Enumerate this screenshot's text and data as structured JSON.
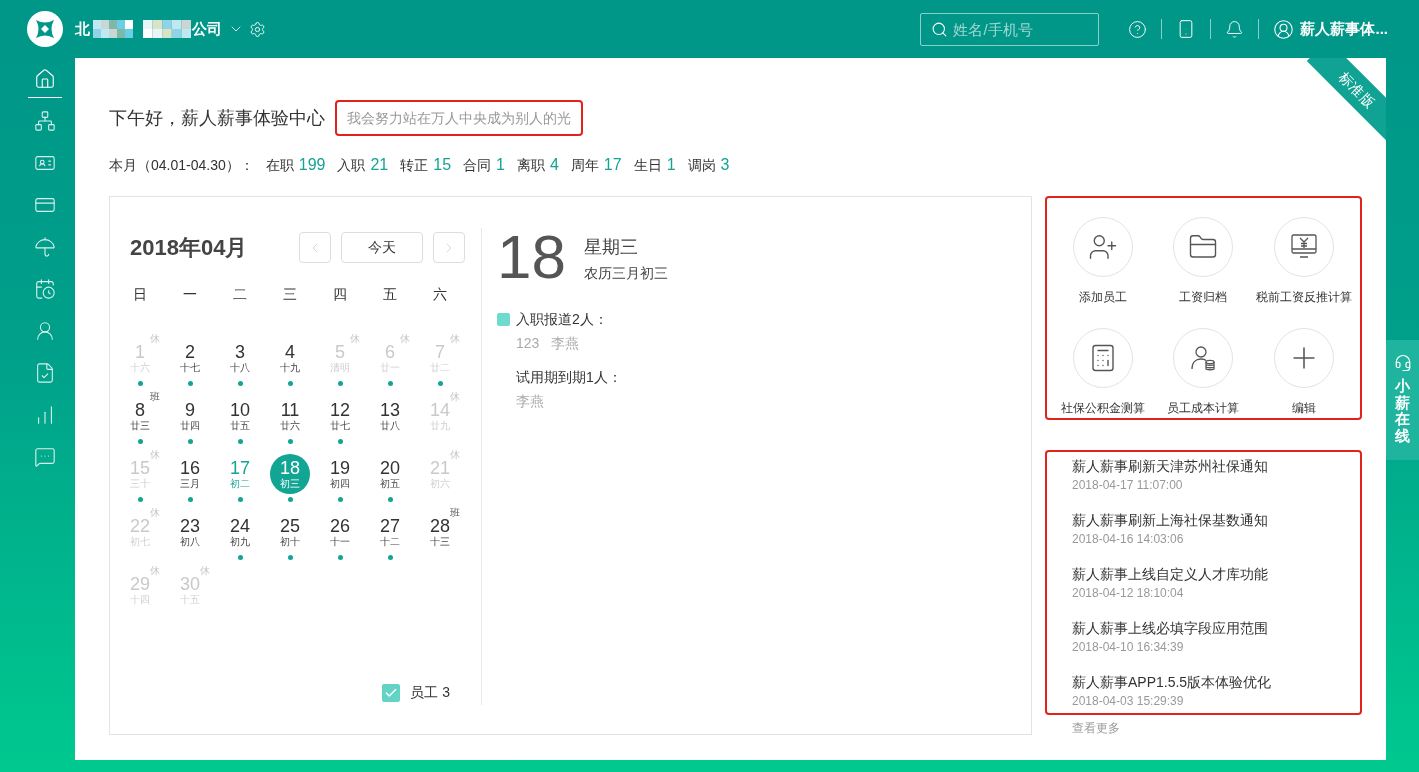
{
  "header": {
    "company_prefix": "北",
    "company_suffix": "公司",
    "search": {
      "placeholder": "姓名/手机号"
    },
    "user_name": "薪人薪事体..."
  },
  "sidebar": {
    "items": [
      {
        "selected": true
      },
      {
        "selected": false
      },
      {
        "selected": false
      },
      {
        "selected": false
      },
      {
        "selected": false
      },
      {
        "selected": false
      },
      {
        "selected": false
      },
      {
        "selected": false
      },
      {
        "selected": false
      },
      {
        "selected": false
      }
    ]
  },
  "edition_ribbon": "标准版",
  "greeting": "下午好，薪人薪事体验中心",
  "motto": {
    "text": "我会努力站在万人中央成为别人的光",
    "highlighted": true
  },
  "month_stats": {
    "label": "本月（04.01-04.30）：",
    "items": [
      {
        "label": "在职",
        "value": "199"
      },
      {
        "label": "入职",
        "value": "21"
      },
      {
        "label": "转正",
        "value": "15"
      },
      {
        "label": "合同",
        "value": "1"
      },
      {
        "label": "离职",
        "value": "4"
      },
      {
        "label": "周年",
        "value": "17"
      },
      {
        "label": "生日",
        "value": "1"
      },
      {
        "label": "调岗",
        "value": "3"
      }
    ]
  },
  "calendar": {
    "title": "2018年04月",
    "today_button": "今天",
    "weekdays": [
      "日",
      "一",
      "二",
      "三",
      "四",
      "五",
      "六"
    ],
    "weeks": [
      [
        {
          "day": "1",
          "lunar": "十六",
          "mark": "休",
          "muted": true,
          "accent": false,
          "selected": false,
          "dot": true
        },
        {
          "day": "2",
          "lunar": "十七",
          "muted": false,
          "accent": false,
          "selected": false,
          "dot": true
        },
        {
          "day": "3",
          "lunar": "十八",
          "muted": false,
          "accent": false,
          "selected": false,
          "dot": true
        },
        {
          "day": "4",
          "lunar": "十九",
          "muted": false,
          "accent": false,
          "selected": false,
          "dot": true
        },
        {
          "day": "5",
          "lunar": "清明",
          "mark": "休",
          "muted": true,
          "accent": false,
          "selected": false,
          "dot": true
        },
        {
          "day": "6",
          "lunar": "廿一",
          "mark": "休",
          "muted": true,
          "accent": false,
          "selected": false,
          "dot": true
        },
        {
          "day": "7",
          "lunar": "廿二",
          "mark": "休",
          "muted": true,
          "accent": false,
          "selected": false,
          "dot": true
        }
      ],
      [
        {
          "day": "8",
          "lunar": "廿三",
          "mark": "班",
          "muted": false,
          "accent": false,
          "selected": false,
          "dot": true
        },
        {
          "day": "9",
          "lunar": "廿四",
          "muted": false,
          "accent": false,
          "selected": false,
          "dot": true
        },
        {
          "day": "10",
          "lunar": "廿五",
          "muted": false,
          "accent": false,
          "selected": false,
          "dot": true
        },
        {
          "day": "11",
          "lunar": "廿六",
          "muted": false,
          "accent": false,
          "selected": false,
          "dot": true
        },
        {
          "day": "12",
          "lunar": "廿七",
          "muted": false,
          "accent": false,
          "selected": false,
          "dot": true
        },
        {
          "day": "13",
          "lunar": "廿八",
          "muted": false,
          "accent": false,
          "selected": false,
          "dot": false
        },
        {
          "day": "14",
          "lunar": "廿九",
          "mark": "休",
          "muted": true,
          "accent": false,
          "selected": false,
          "dot": false
        }
      ],
      [
        {
          "day": "15",
          "lunar": "三十",
          "mark": "休",
          "muted": true,
          "accent": false,
          "selected": false,
          "dot": true
        },
        {
          "day": "16",
          "lunar": "三月",
          "muted": false,
          "accent": false,
          "selected": false,
          "dot": true
        },
        {
          "day": "17",
          "lunar": "初二",
          "muted": false,
          "accent": true,
          "selected": false,
          "dot": true
        },
        {
          "day": "18",
          "lunar": "初三",
          "muted": false,
          "accent": false,
          "selected": true,
          "dot": true
        },
        {
          "day": "19",
          "lunar": "初四",
          "muted": false,
          "accent": false,
          "selected": false,
          "dot": true
        },
        {
          "day": "20",
          "lunar": "初五",
          "muted": false,
          "accent": false,
          "selected": false,
          "dot": true
        },
        {
          "day": "21",
          "lunar": "初六",
          "mark": "休",
          "muted": true,
          "accent": false,
          "selected": false,
          "dot": false
        }
      ],
      [
        {
          "day": "22",
          "lunar": "初七",
          "mark": "休",
          "muted": true,
          "accent": false,
          "selected": false,
          "dot": false
        },
        {
          "day": "23",
          "lunar": "初八",
          "muted": false,
          "accent": false,
          "selected": false,
          "dot": false
        },
        {
          "day": "24",
          "lunar": "初九",
          "muted": false,
          "accent": false,
          "selected": false,
          "dot": true
        },
        {
          "day": "25",
          "lunar": "初十",
          "muted": false,
          "accent": false,
          "selected": false,
          "dot": true
        },
        {
          "day": "26",
          "lunar": "十一",
          "muted": false,
          "accent": false,
          "selected": false,
          "dot": true
        },
        {
          "day": "27",
          "lunar": "十二",
          "muted": false,
          "accent": false,
          "selected": false,
          "dot": true
        },
        {
          "day": "28",
          "lunar": "十三",
          "mark": "班",
          "muted": false,
          "accent": false,
          "selected": false,
          "dot": false
        }
      ],
      [
        {
          "day": "29",
          "lunar": "十四",
          "mark": "休",
          "muted": true,
          "accent": false,
          "selected": false,
          "dot": false
        },
        {
          "day": "30",
          "lunar": "十五",
          "mark": "休",
          "muted": true,
          "accent": false,
          "selected": false,
          "dot": false
        }
      ]
    ],
    "filter": {
      "label": "员工 3",
      "checked": true
    }
  },
  "day_detail": {
    "day": "18",
    "weekday": "星期三",
    "lunar": "农历三月初三",
    "groups": [
      {
        "title": "入职报道2人：",
        "color": "#6ddccf",
        "names": [
          "123",
          "李燕"
        ]
      },
      {
        "title": "试用期到期1人：",
        "names": [
          "李燕"
        ]
      }
    ]
  },
  "quick_actions": {
    "highlighted": true,
    "items": [
      {
        "label": "添加员工"
      },
      {
        "label": "工资归档"
      },
      {
        "label": "税前工资反推计算"
      },
      {
        "label": "社保公积金测算"
      },
      {
        "label": "员工成本计算"
      },
      {
        "label": "编辑"
      }
    ]
  },
  "news": {
    "highlighted": true,
    "items": [
      {
        "title": "薪人薪事刷新天津苏州社保通知",
        "time": "2018-04-17 11:07:00"
      },
      {
        "title": "薪人薪事刷新上海社保基数通知",
        "time": "2018-04-16 14:03:06"
      },
      {
        "title": "薪人薪事上线自定义人才库功能",
        "time": "2018-04-12 18:10:04"
      },
      {
        "title": "薪人薪事上线必填字段应用范围",
        "time": "2018-04-10 16:34:39"
      },
      {
        "title": "薪人薪事APP1.5.5版本体验优化",
        "time": "2018-04-03 15:29:39"
      }
    ],
    "more": "查看更多"
  },
  "support_tab": "小薪在线"
}
